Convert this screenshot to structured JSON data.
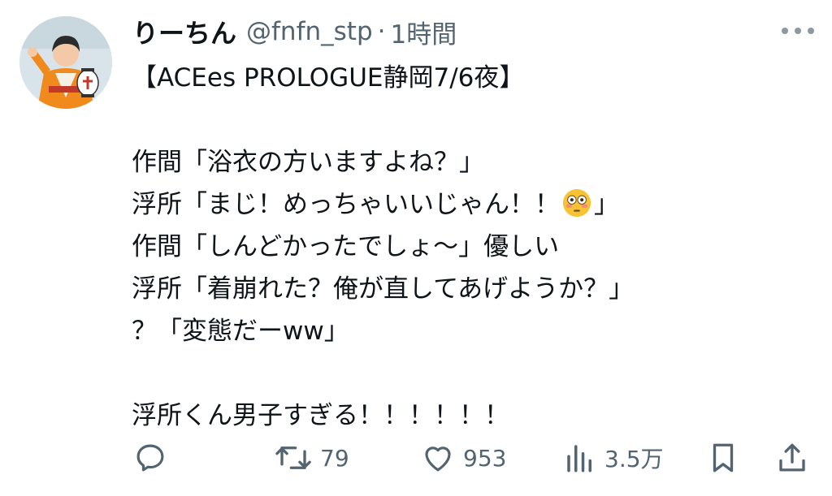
{
  "user": {
    "display_name": "りーちん",
    "handle": "@fnfn_stp",
    "separator": "·",
    "time": "1時間"
  },
  "tweet": {
    "lines": [
      "【ACEes PROLOGUE静岡7/6夜】",
      "",
      "作間「浴衣の方いますよね？」",
      "浮所「まじ！めっちゃいいじゃん！！",
      "」",
      "作間「しんどかったでしょ〜」優しい",
      "浮所「着崩れた？俺が直してあげようか？」",
      "？「変態だーww」",
      "",
      "浮所くん男子すぎる！！！！！！"
    ]
  },
  "actions": {
    "retweets": "79",
    "likes": "953",
    "views": "3.5万"
  },
  "icons": {
    "avatar": "avatar-image",
    "more": "more-options-icon",
    "reply": "reply-icon",
    "retweet": "retweet-icon",
    "like": "heart-icon",
    "views": "views-chart-icon",
    "bookmark": "bookmark-icon",
    "share": "share-icon",
    "emoji": "flushed-face-emoji"
  },
  "colors": {
    "text": "#0f1419",
    "secondary": "#536471"
  }
}
